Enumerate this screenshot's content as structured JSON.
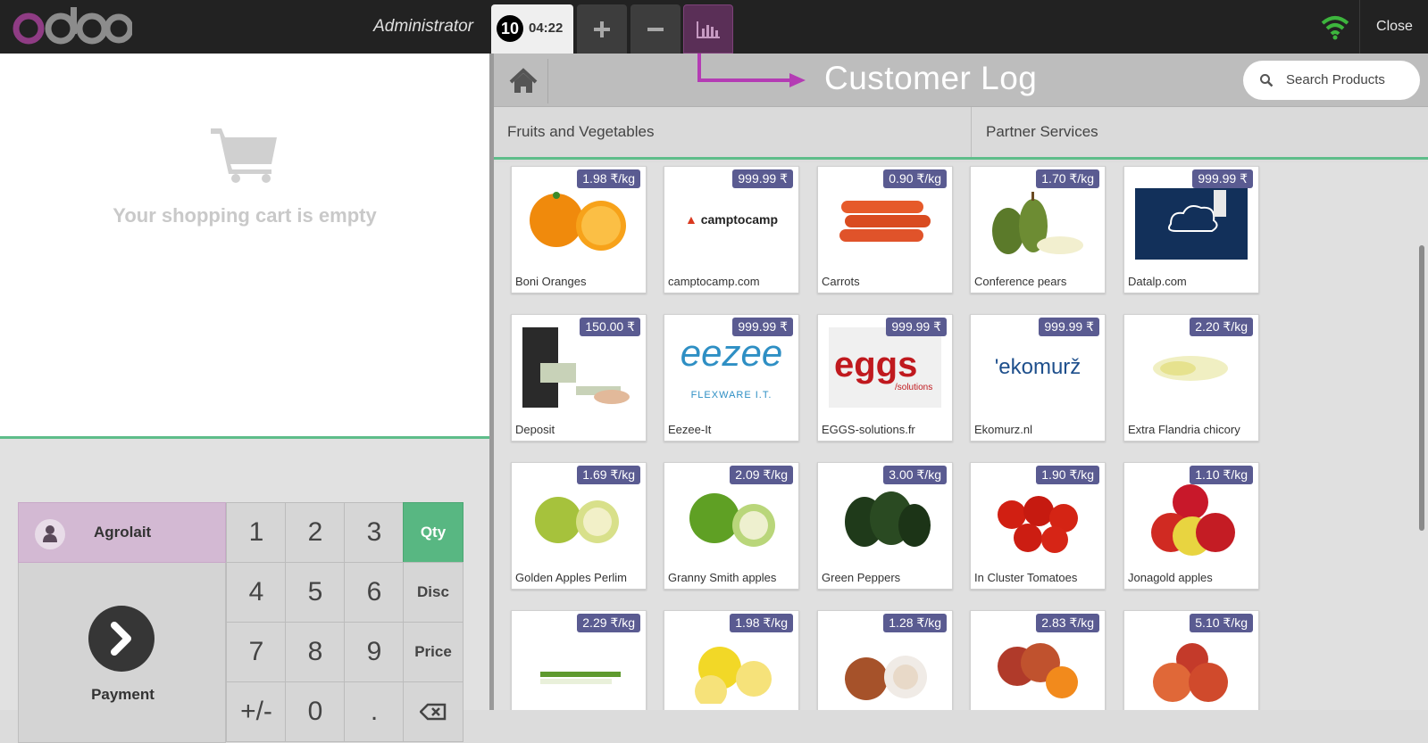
{
  "header": {
    "user": "Administrator",
    "order_number": "10",
    "order_time": "04:22",
    "close_label": "Close"
  },
  "cart": {
    "empty_text": "Your shopping cart is empty"
  },
  "numpad": {
    "customer": "Agrolait",
    "payment_label": "Payment",
    "keys": [
      "1",
      "2",
      "3",
      "4",
      "5",
      "6",
      "7",
      "8",
      "9",
      "+/-",
      "0",
      "."
    ],
    "modes": [
      "Qty",
      "Disc",
      "Price"
    ],
    "selected_mode": "Qty"
  },
  "products_screen": {
    "annotation": "Customer Log",
    "search_placeholder": "Search Products",
    "categories": [
      "Fruits and Vegetables",
      "Partner Services"
    ]
  },
  "products": [
    {
      "name": "Boni Oranges",
      "price": "1.98 ₹/kg"
    },
    {
      "name": "camptocamp.com",
      "price": "999.99 ₹"
    },
    {
      "name": "Carrots",
      "price": "0.90 ₹/kg"
    },
    {
      "name": "Conference pears",
      "price": "1.70 ₹/kg"
    },
    {
      "name": "Datalp.com",
      "price": "999.99 ₹"
    },
    {
      "name": "Deposit",
      "price": "150.00 ₹"
    },
    {
      "name": "Eezee-It",
      "price": "999.99 ₹"
    },
    {
      "name": "EGGS-solutions.fr",
      "price": "999.99 ₹"
    },
    {
      "name": "Ekomurz.nl",
      "price": "999.99 ₹"
    },
    {
      "name": "Extra Flandria chicory",
      "price": "2.20 ₹/kg"
    },
    {
      "name": "Golden Apples Perlim",
      "price": "1.69 ₹/kg"
    },
    {
      "name": "Granny Smith apples",
      "price": "2.09 ₹/kg"
    },
    {
      "name": "Green Peppers",
      "price": "3.00 ₹/kg"
    },
    {
      "name": "In Cluster Tomatoes",
      "price": "1.90 ₹/kg"
    },
    {
      "name": "Jonagold apples",
      "price": "1.10 ₹/kg"
    },
    {
      "name": "",
      "price": "2.29 ₹/kg"
    },
    {
      "name": "",
      "price": "1.98 ₹/kg"
    },
    {
      "name": "",
      "price": "1.28 ₹/kg"
    },
    {
      "name": "",
      "price": "2.83 ₹/kg"
    },
    {
      "name": "",
      "price": "5.10 ₹/kg"
    }
  ],
  "product_logos": {
    "camptocamp": "camptocamp",
    "eezee": "eezee",
    "eezee_sub": "FLEXWARE I.T.",
    "eggs": "eggs",
    "eggs_sub": "/solutions",
    "ekomurz": "'ekomurž"
  },
  "colors": {
    "accent_green": "#5ebd8a",
    "price_badge": "#5a5b91",
    "customer_bg": "#d3b9d3",
    "annotation_arrow": "#b43cb4"
  }
}
